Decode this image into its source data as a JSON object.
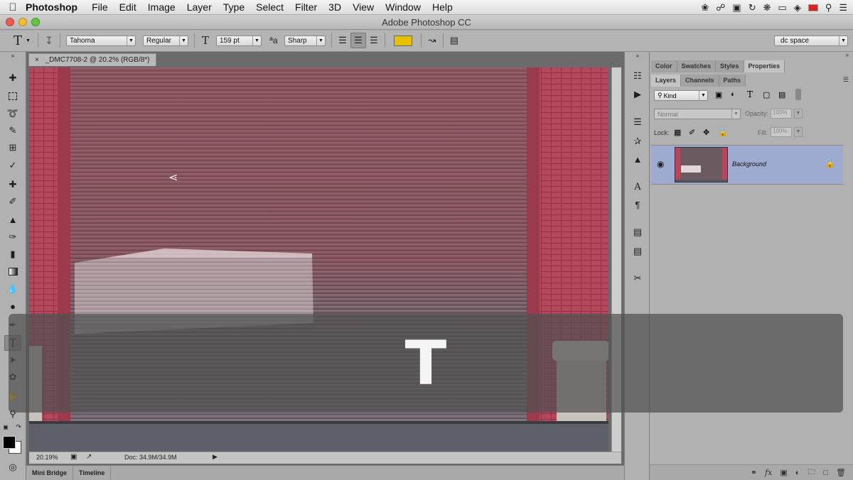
{
  "menubar": {
    "app": "Photoshop",
    "items": [
      "File",
      "Edit",
      "Image",
      "Layer",
      "Type",
      "Select",
      "Filter",
      "3D",
      "View",
      "Window",
      "Help"
    ]
  },
  "titlebar": {
    "title": "Adobe Photoshop CC"
  },
  "options": {
    "font_family": "Tahoma",
    "font_style": "Regular",
    "font_size": "159 pt",
    "aa_symbol": "ªa",
    "antialias": "Sharp",
    "text_color": "#e6c000",
    "workspace": "dc space"
  },
  "document": {
    "tab_title": "_DMC7708-2 @ 20.2% (RGB/8*)",
    "zoom": "20.19%",
    "doc_size": "Doc: 34.9M/34.9M"
  },
  "bottom_tabs": [
    "Mini Bridge",
    "Timeline"
  ],
  "panels": {
    "top_tabs": [
      "Color",
      "Swatches",
      "Styles",
      "Properties"
    ],
    "layer_tabs": [
      "Layers",
      "Channels",
      "Paths"
    ],
    "kind_label": "Kind",
    "blend_mode": "Normal",
    "opacity_label": "Opacity:",
    "opacity_value": "100%",
    "lock_label": "Lock:",
    "fill_label": "Fill:",
    "fill_value": "100%",
    "layer_name": "Background"
  },
  "overlay": {
    "text": "T"
  },
  "colors": {
    "selection": "#9eaad0",
    "door_red": "#b84b5e"
  }
}
